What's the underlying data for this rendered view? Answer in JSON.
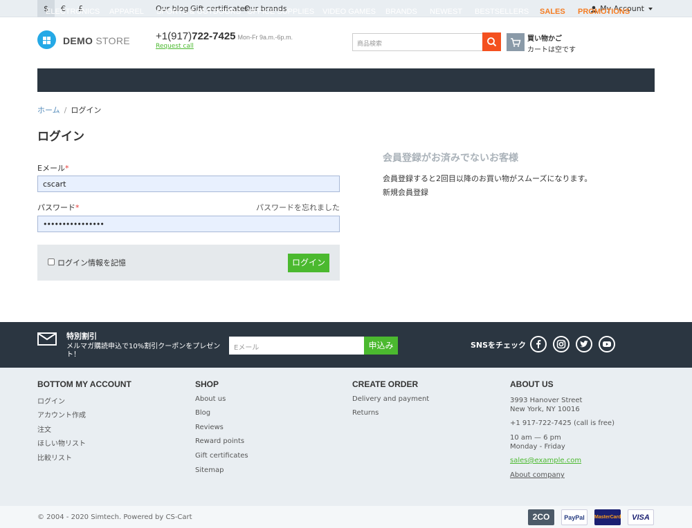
{
  "topbar": {
    "currencies": [
      "$",
      "€",
      "£"
    ],
    "links": [
      "Our blog",
      "Gift certificates",
      "Our brands"
    ],
    "account": "My Account"
  },
  "header": {
    "logo_bold": "DEMO",
    "logo_light": "STORE",
    "phone_code": "+1(917)",
    "phone_number": "722-7425",
    "phone_hours": "Mon-Fr 9a.m.-6p.m.",
    "request_call": "Request call",
    "search_placeholder": "商品検索",
    "cart_title": "買い物かご",
    "cart_status": "カートは空です"
  },
  "nav": [
    "ELECTRONICS",
    "APPAREL",
    "SPORTS & OUTDOORS",
    "OFFICE SUPPLIES",
    "VIDEO GAMES",
    "BRANDS",
    "NEWEST",
    "BESTSELLERS",
    "SALES",
    "PROMOTIONS"
  ],
  "breadcrumb": {
    "home": "ホーム",
    "separator": "/",
    "current": "ログイン"
  },
  "login": {
    "title": "ログイン",
    "email_label": "Eメール",
    "email_value": "cscart",
    "password_label": "パスワード",
    "password_value": "••••••••••••••••",
    "required_mark": "*",
    "forgot": "パスワードを忘れました",
    "remember": "ログイン情報を記憶",
    "button": "ログイン"
  },
  "register": {
    "title": "会員登録がお済みでないお客様",
    "description": "会員登録すると2回目以降のお買い物がスムーズになります。",
    "link": "新規会員登録"
  },
  "newsletter": {
    "title": "特別割引",
    "subtitle": "メルマガ購読申込で10%割引クーポンをプレゼント！",
    "input_placeholder": "Eメール",
    "button": "申込み",
    "sns_label": "SNSをチェック"
  },
  "footer": {
    "col1": {
      "title": "BOTTOM MY ACCOUNT",
      "links": [
        "ログイン",
        "アカウント作成",
        "注文",
        "ほしい物リスト",
        "比較リスト"
      ]
    },
    "col2": {
      "title": "SHOP",
      "links": [
        "About us",
        "Blog",
        "Reviews",
        "Reward points",
        "Gift certificates",
        "Sitemap"
      ]
    },
    "col3": {
      "title": "CREATE ORDER",
      "links": [
        "Delivery and payment",
        "Returns"
      ]
    },
    "col4": {
      "title": "ABOUT US",
      "address1": "3993 Hanover Street",
      "address2": "New York, NY 10016",
      "phone": "+1 917-722-7425 (call is free)",
      "hours1": "10 am — 6 pm",
      "hours2": "Monday - Friday",
      "email": "sales@example.com",
      "about": "About company"
    },
    "copyright": "© 2004 - 2020 Simtech.  Powered by CS-Cart",
    "payments": [
      "2CO",
      "PayPal",
      "MasterCard",
      "VISA"
    ]
  },
  "colors": {
    "accent_green": "#4bb92f",
    "nav_bg": "#2b3641",
    "promo_orange": "#f57d23",
    "search_orange": "#f4501f"
  }
}
